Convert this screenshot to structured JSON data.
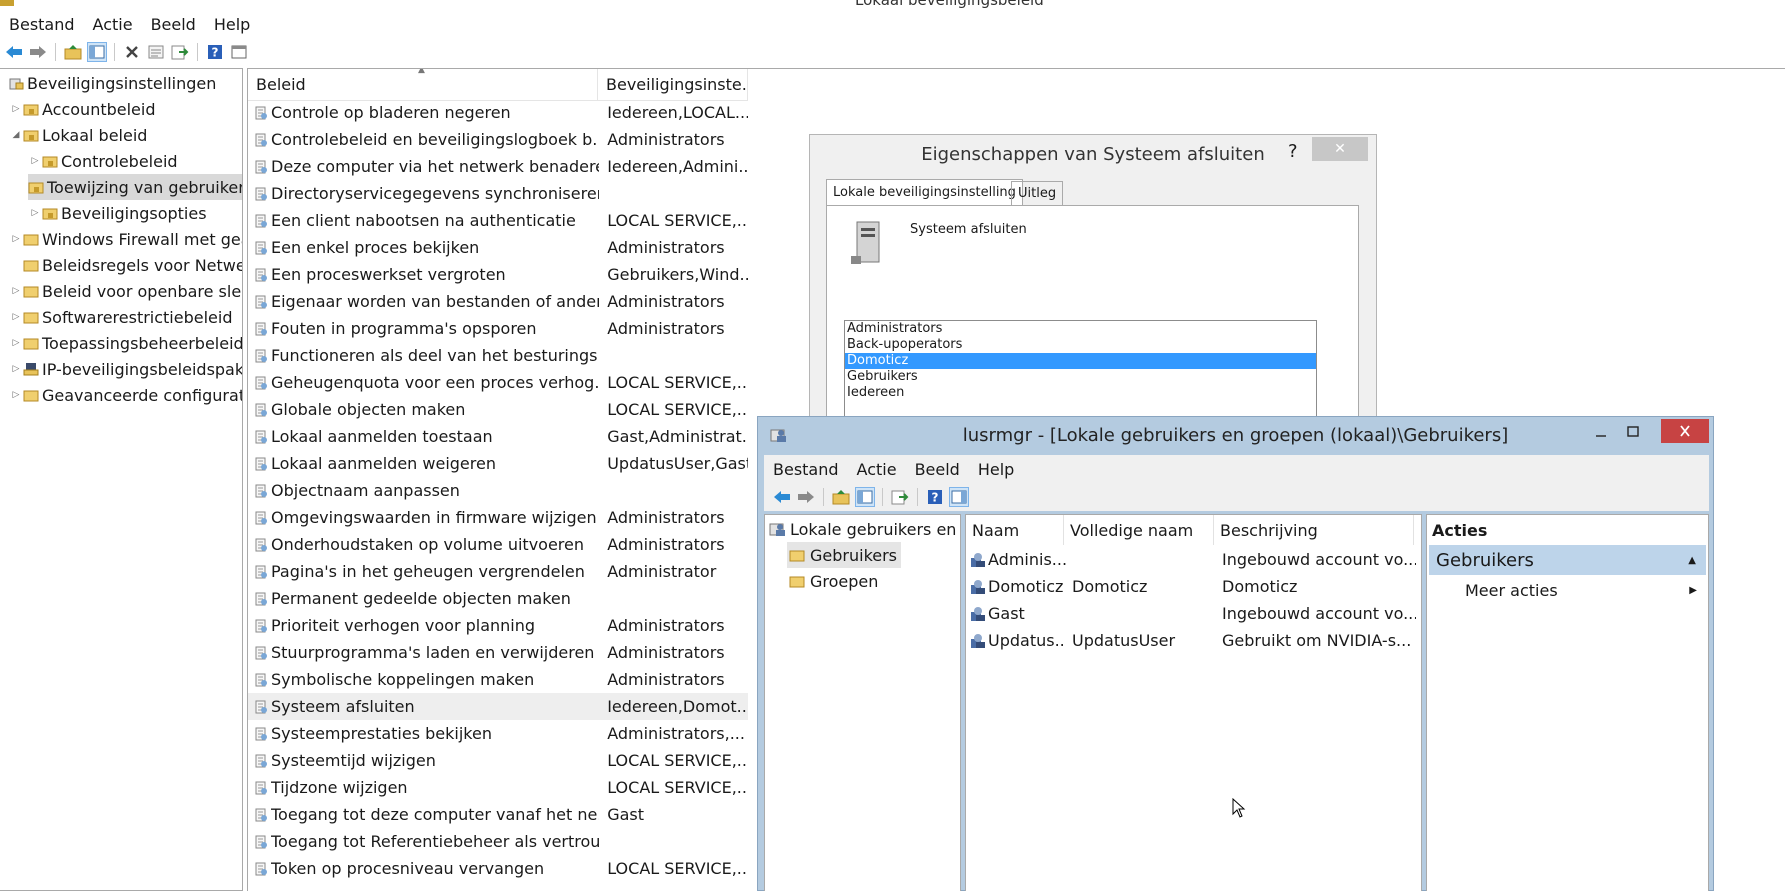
{
  "window": {
    "title": "Lokaal beveiligingsbeleid"
  },
  "menu": [
    "Bestand",
    "Actie",
    "Beeld",
    "Help"
  ],
  "tree": [
    {
      "label": "Beveiligingsinstellingen",
      "icon": "security-settings-icon",
      "expand": ""
    },
    {
      "label": "Accountbeleid",
      "icon": "folder-lock-icon",
      "expand": "▷"
    },
    {
      "label": "Lokaal beleid",
      "icon": "folder-lock-icon",
      "expand": "◢"
    },
    {
      "label": "Controlebeleid",
      "icon": "folder-lock-icon",
      "expand": "▷"
    },
    {
      "label": "Toewijzing van gebruikersrechten",
      "icon": "folder-lock-icon",
      "expand": ""
    },
    {
      "label": "Beveiligingsopties",
      "icon": "folder-lock-icon",
      "expand": "▷"
    },
    {
      "label": "Windows Firewall met geavanceerde beveiliging",
      "icon": "folder-icon",
      "expand": "▷"
    },
    {
      "label": "Beleidsregels voor Netwerklijstbeheer",
      "icon": "folder-icon",
      "expand": ""
    },
    {
      "label": "Beleid voor openbare sleutels",
      "icon": "folder-icon",
      "expand": "▷"
    },
    {
      "label": "Softwarerestrictiebeleid",
      "icon": "folder-icon",
      "expand": "▷"
    },
    {
      "label": "Toepassingsbeheerbeleid",
      "icon": "folder-icon",
      "expand": "▷"
    },
    {
      "label": "IP-beveiligingsbeleidspakketten",
      "icon": "ip-security-icon",
      "expand": "▷"
    },
    {
      "label": "Geavanceerde configuratie",
      "icon": "folder-icon",
      "expand": "▷"
    }
  ],
  "policy_list": {
    "columns": [
      "Beleid",
      "Beveiligingsinste..."
    ],
    "rows": [
      {
        "name": "Controle op bladeren negeren",
        "setting": "Iedereen,LOCAL..."
      },
      {
        "name": "Controlebeleid en beveiligingslogboek b...",
        "setting": "Administrators"
      },
      {
        "name": "Deze computer via het netwerk benaderen",
        "setting": "Iedereen,Admini..."
      },
      {
        "name": "Directoryservicegegevens synchroniseren",
        "setting": ""
      },
      {
        "name": "Een client nabootsen na authenticatie",
        "setting": "LOCAL SERVICE,..."
      },
      {
        "name": "Een enkel proces bekijken",
        "setting": "Administrators"
      },
      {
        "name": "Een proceswerkset vergroten",
        "setting": "Gebruikers,Wind..."
      },
      {
        "name": "Eigenaar worden van bestanden of ander...",
        "setting": "Administrators"
      },
      {
        "name": "Fouten in programma's opsporen",
        "setting": "Administrators"
      },
      {
        "name": "Functioneren als deel van het besturings...",
        "setting": ""
      },
      {
        "name": "Geheugenquota voor een proces verhog...",
        "setting": "LOCAL SERVICE,..."
      },
      {
        "name": "Globale objecten maken",
        "setting": "LOCAL SERVICE,..."
      },
      {
        "name": "Lokaal aanmelden toestaan",
        "setting": "Gast,Administrat..."
      },
      {
        "name": "Lokaal aanmelden weigeren",
        "setting": "UpdatusUser,Gast"
      },
      {
        "name": "Objectnaam aanpassen",
        "setting": ""
      },
      {
        "name": "Omgevingswaarden in firmware wijzigen",
        "setting": "Administrators"
      },
      {
        "name": "Onderhoudstaken op volume uitvoeren",
        "setting": "Administrators"
      },
      {
        "name": "Pagina's in het geheugen vergrendelen",
        "setting": "Administrator"
      },
      {
        "name": "Permanent gedeelde objecten maken",
        "setting": ""
      },
      {
        "name": "Prioriteit verhogen voor planning",
        "setting": "Administrators"
      },
      {
        "name": "Stuurprogramma's laden en verwijderen",
        "setting": "Administrators"
      },
      {
        "name": "Symbolische koppelingen maken",
        "setting": "Administrators"
      },
      {
        "name": "Systeem afsluiten",
        "setting": "Iedereen,Domot..."
      },
      {
        "name": "Systeemprestaties bekijken",
        "setting": "Administrators,..."
      },
      {
        "name": "Systeemtijd wijzigen",
        "setting": "LOCAL SERVICE,..."
      },
      {
        "name": "Tijdzone wijzigen",
        "setting": "LOCAL SERVICE,..."
      },
      {
        "name": "Toegang tot deze computer vanaf het ne...",
        "setting": "Gast"
      },
      {
        "name": "Toegang tot Referentiebeheer als vertrou...",
        "setting": ""
      },
      {
        "name": "Token op procesniveau vervangen",
        "setting": "LOCAL SERVICE,..."
      }
    ]
  },
  "dialog": {
    "title": "Eigenschappen van Systeem afsluiten",
    "help": "?",
    "close": "✕",
    "tabs": [
      "Lokale beveiligingsinstelling",
      "Uitleg"
    ],
    "policy_name": "Systeem afsluiten",
    "members": [
      "Administrators",
      "Back-upoperators",
      "Domoticz",
      "Gebruikers",
      "Iedereen"
    ]
  },
  "lusrmgr": {
    "title": "lusrmgr - [Lokale gebruikers en groepen (lokaal)\\Gebruikers]",
    "menu": [
      "Bestand",
      "Actie",
      "Beeld",
      "Help"
    ],
    "tree": [
      {
        "label": "Lokale gebruikers en groepen (lokaal)"
      },
      {
        "label": "Gebruikers"
      },
      {
        "label": "Groepen"
      }
    ],
    "columns": [
      "Naam",
      "Volledige naam",
      "Beschrijving"
    ],
    "users": [
      {
        "name": "Adminis...",
        "full": "",
        "desc": "Ingebouwd account vo..."
      },
      {
        "name": "Domoticz",
        "full": "Domoticz",
        "desc": "Domoticz"
      },
      {
        "name": "Gast",
        "full": "",
        "desc": "Ingebouwd account vo..."
      },
      {
        "name": "Updatus...",
        "full": "UpdatusUser",
        "desc": "Gebruikt om NVIDIA-s..."
      }
    ],
    "actions": {
      "header": "Acties",
      "section": "Gebruikers",
      "item": "Meer acties"
    }
  },
  "colors": {
    "selection_blue": "#3399ff",
    "close_red": "#c74343",
    "lusr_frame": "#b4cbe0",
    "action_section": "#bdd4ea"
  }
}
